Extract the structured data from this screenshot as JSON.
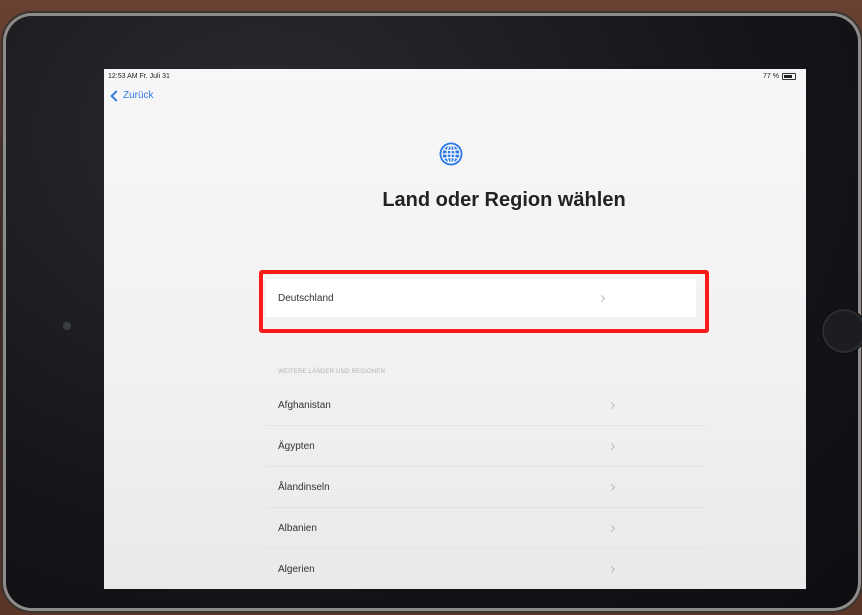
{
  "status_bar": {
    "time": "12:53 AM  Fr. Juli 31",
    "battery": "77 %"
  },
  "nav": {
    "back_label": "Zurück"
  },
  "icon": "globe-icon",
  "title": "Land oder Region wählen",
  "selected_country": "Deutschland",
  "section_header": "WEITERE LÄNDER UND REGIONEN",
  "countries": [
    "Afghanistan",
    "Ägypten",
    "Ålandinseln",
    "Albanien",
    "Algerien"
  ],
  "colors": {
    "accent": "#2f7ae5",
    "highlight": "#ff1a1a"
  }
}
